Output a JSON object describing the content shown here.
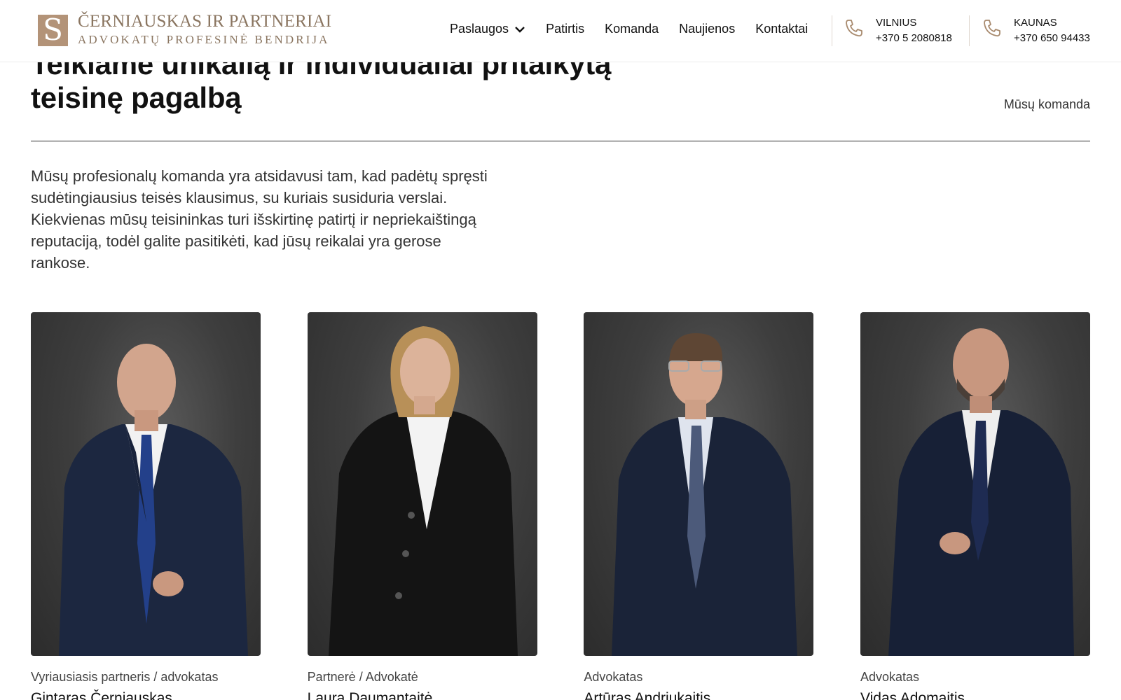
{
  "header": {
    "logo": {
      "name": "ČERNIAUSKAS IR PARTNERIAI",
      "subtitle": "ADVOKATŲ PROFESINĖ BENDRIJA",
      "mark_letter": "S",
      "brand_color": "#b39378"
    },
    "nav": [
      {
        "label": "Paslaugos",
        "has_dropdown": true
      },
      {
        "label": "Patirtis"
      },
      {
        "label": "Komanda"
      },
      {
        "label": "Naujienos"
      },
      {
        "label": "Kontaktai"
      }
    ],
    "offices": [
      {
        "city": "VILNIUS",
        "phone": "+370 5 2080818",
        "icon": "phone-icon"
      },
      {
        "city": "KAUNAS",
        "phone": "+370 650 94433",
        "icon": "phone-icon"
      }
    ]
  },
  "main": {
    "title": "Teikiame unikalią ir individualiai pritaikytą teisinę pagalbą",
    "section_link": "Mūsų komanda",
    "intro": "Mūsų profesionalų komanda yra atsidavusi tam, kad padėtų spręsti sudėtingiausius teisės klausimus, su kuriais susiduria verslai. Kiekvienas mūsų teisininkas turi išskirtinę patirtį ir nepriekaištingą reputaciją, todėl galite pasitikėti, kad jūsų reikalai yra gerose rankose.",
    "team": [
      {
        "role": "Vyriausiasis partneris / advokatas",
        "name": "Gintaras Černiauskas"
      },
      {
        "role": "Partnerė / Advokatė",
        "name": "Laura Daumantaitė"
      },
      {
        "role": "Advokatas",
        "name": "Artūras Andriukaitis"
      },
      {
        "role": "Advokatas",
        "name": "Vidas Adomaitis"
      }
    ]
  }
}
